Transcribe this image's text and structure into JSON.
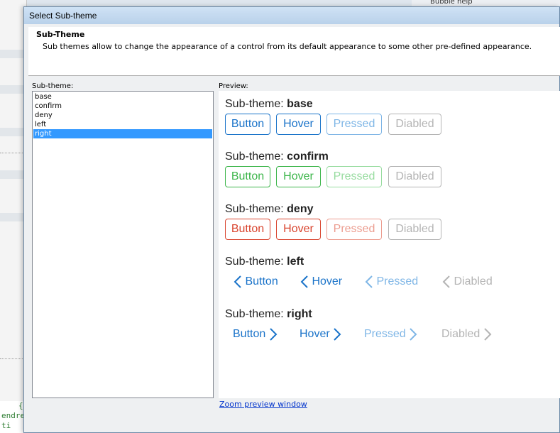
{
  "dialog": {
    "title": "Select Sub-theme",
    "header_title": "Sub-Theme",
    "header_description": "Sub themes allow to change the appearance of a control from its default appearance to some other pre-defined appearance.",
    "list_label": "Sub-theme:",
    "preview_label": "Preview:",
    "zoom_link": "Zoom preview window"
  },
  "subthemes": [
    {
      "label": "base",
      "selected": false
    },
    {
      "label": "confirm",
      "selected": false
    },
    {
      "label": "deny",
      "selected": false
    },
    {
      "label": "left",
      "selected": false
    },
    {
      "label": "right",
      "selected": true
    }
  ],
  "preview": {
    "section_prefix": "Sub-theme: ",
    "sections": [
      {
        "name": "base",
        "buttons": [
          "Button",
          "Hover",
          "Pressed",
          "Diabled"
        ],
        "colors": [
          "#1a73c9",
          "#1a73c9",
          "#7fb6e6",
          "#b4b4b4"
        ]
      },
      {
        "name": "confirm",
        "buttons": [
          "Button",
          "Hover",
          "Pressed",
          "Diabled"
        ],
        "colors": [
          "#3cb54a",
          "#3cb54a",
          "#98dca0",
          "#b4b4b4"
        ]
      },
      {
        "name": "deny",
        "buttons": [
          "Button",
          "Hover",
          "Pressed",
          "Diabled"
        ],
        "colors": [
          "#d9442e",
          "#d9442e",
          "#ec9d90",
          "#b4b4b4"
        ]
      },
      {
        "name": "left",
        "buttons": [
          "Button",
          "Hover",
          "Pressed",
          "Diabled"
        ],
        "colors": [
          "#1a73c9",
          "#1a73c9",
          "#7fb6e6",
          "#b4b4b4"
        ]
      },
      {
        "name": "right",
        "buttons": [
          "Button",
          "Hover",
          "Pressed",
          "Diabled"
        ],
        "colors": [
          "#1a73c9",
          "#1a73c9",
          "#7fb6e6",
          "#b4b4b4"
        ]
      }
    ]
  },
  "background": {
    "right_panel_text": "Bubble help",
    "code_lines": [
      "{(",
      "endre",
      "ti"
    ]
  }
}
